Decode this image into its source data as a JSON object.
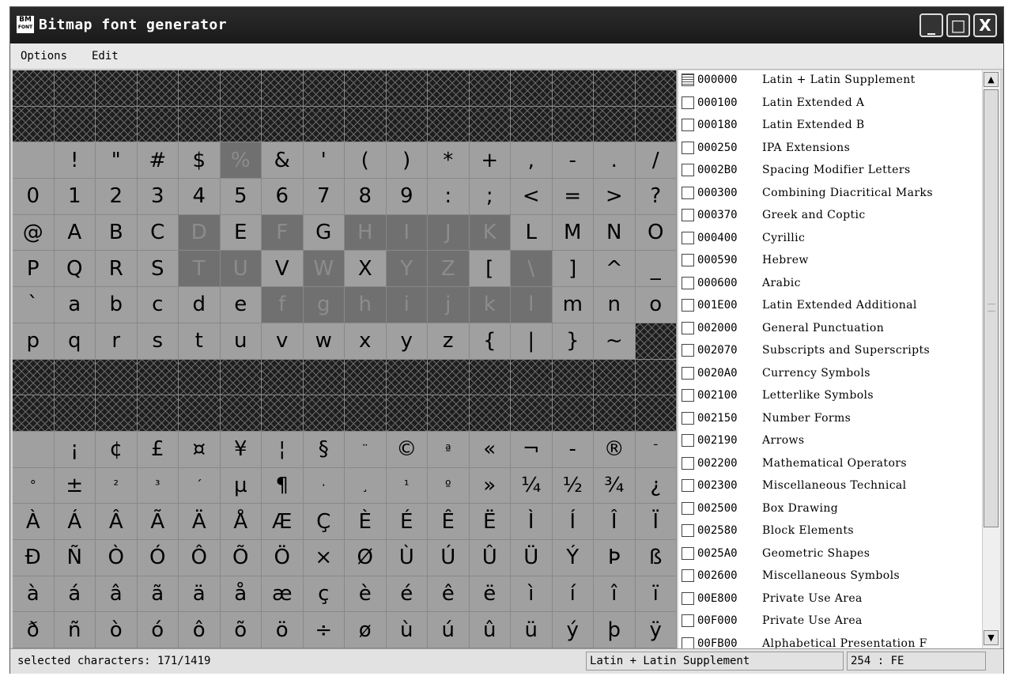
{
  "window": {
    "app_icon_top": "BM",
    "app_icon_bottom": "FONT",
    "title": "Bitmap font generator"
  },
  "window_controls": {
    "minimize": "_",
    "maximize": "□",
    "close": "X"
  },
  "menu": [
    "Options",
    "Edit"
  ],
  "char_grid": {
    "columns": 16,
    "rows": [
      {
        "chars": [
          "",
          "",
          "",
          "",
          "",
          "",
          "",
          "",
          "",
          "",
          "",
          "",
          "",
          "",
          "",
          ""
        ],
        "unavailable": [
          0,
          1,
          2,
          3,
          4,
          5,
          6,
          7,
          8,
          9,
          10,
          11,
          12,
          13,
          14,
          15
        ],
        "selected": []
      },
      {
        "chars": [
          "",
          "",
          "",
          "",
          "",
          "",
          "",
          "",
          "",
          "",
          "",
          "",
          "",
          "",
          "",
          ""
        ],
        "unavailable": [
          0,
          1,
          2,
          3,
          4,
          5,
          6,
          7,
          8,
          9,
          10,
          11,
          12,
          13,
          14,
          15
        ],
        "selected": []
      },
      {
        "chars": [
          " ",
          "!",
          "\"",
          "#",
          "$",
          "%",
          "&",
          "'",
          "(",
          ")",
          "*",
          "+",
          ",",
          "-",
          ".",
          "/"
        ],
        "unavailable": [],
        "selected": [
          5
        ]
      },
      {
        "chars": [
          "0",
          "1",
          "2",
          "3",
          "4",
          "5",
          "6",
          "7",
          "8",
          "9",
          ":",
          ";",
          "<",
          "=",
          ">",
          "?"
        ],
        "unavailable": [],
        "selected": []
      },
      {
        "chars": [
          "@",
          "A",
          "B",
          "C",
          "D",
          "E",
          "F",
          "G",
          "H",
          "I",
          "J",
          "K",
          "L",
          "M",
          "N",
          "O"
        ],
        "unavailable": [],
        "selected": [
          4,
          6,
          8,
          9,
          10,
          11
        ]
      },
      {
        "chars": [
          "P",
          "Q",
          "R",
          "S",
          "T",
          "U",
          "V",
          "W",
          "X",
          "Y",
          "Z",
          "[",
          "\\",
          "]",
          "^",
          "_"
        ],
        "unavailable": [],
        "selected": [
          4,
          5,
          7,
          9,
          10,
          12
        ]
      },
      {
        "chars": [
          "`",
          "a",
          "b",
          "c",
          "d",
          "e",
          "f",
          "g",
          "h",
          "i",
          "j",
          "k",
          "l",
          "m",
          "n",
          "o"
        ],
        "unavailable": [],
        "selected": [
          6,
          7,
          8,
          9,
          10,
          11,
          12
        ]
      },
      {
        "chars": [
          "p",
          "q",
          "r",
          "s",
          "t",
          "u",
          "v",
          "w",
          "x",
          "y",
          "z",
          "{",
          "|",
          "}",
          "~",
          ""
        ],
        "unavailable": [
          15
        ],
        "selected": []
      },
      {
        "chars": [
          "",
          "",
          "",
          "",
          "",
          "",
          "",
          "",
          "",
          "",
          "",
          "",
          "",
          "",
          "",
          ""
        ],
        "unavailable": [
          0,
          1,
          2,
          3,
          4,
          5,
          6,
          7,
          8,
          9,
          10,
          11,
          12,
          13,
          14,
          15
        ],
        "selected": []
      },
      {
        "chars": [
          "",
          "",
          "",
          "",
          "",
          "",
          "",
          "",
          "",
          "",
          "",
          "",
          "",
          "",
          "",
          ""
        ],
        "unavailable": [
          0,
          1,
          2,
          3,
          4,
          5,
          6,
          7,
          8,
          9,
          10,
          11,
          12,
          13,
          14,
          15
        ],
        "selected": []
      },
      {
        "chars": [
          " ",
          "¡",
          "¢",
          "£",
          "¤",
          "¥",
          "¦",
          "§",
          "¨",
          "©",
          "ª",
          "«",
          "¬",
          "-",
          "®",
          "¯"
        ],
        "unavailable": [],
        "selected": []
      },
      {
        "chars": [
          "°",
          "±",
          "²",
          "³",
          "´",
          "µ",
          "¶",
          "·",
          "¸",
          "¹",
          "º",
          "»",
          "¼",
          "½",
          "¾",
          "¿"
        ],
        "unavailable": [],
        "selected": []
      },
      {
        "chars": [
          "À",
          "Á",
          "Â",
          "Ã",
          "Ä",
          "Å",
          "Æ",
          "Ç",
          "È",
          "É",
          "Ê",
          "Ë",
          "Ì",
          "Í",
          "Î",
          "Ï"
        ],
        "unavailable": [],
        "selected": []
      },
      {
        "chars": [
          "Ð",
          "Ñ",
          "Ò",
          "Ó",
          "Ô",
          "Õ",
          "Ö",
          "×",
          "Ø",
          "Ù",
          "Ú",
          "Û",
          "Ü",
          "Ý",
          "Þ",
          "ß"
        ],
        "unavailable": [],
        "selected": []
      },
      {
        "chars": [
          "à",
          "á",
          "â",
          "ã",
          "ä",
          "å",
          "æ",
          "ç",
          "è",
          "é",
          "ê",
          "ë",
          "ì",
          "í",
          "î",
          "ï"
        ],
        "unavailable": [],
        "selected": []
      },
      {
        "chars": [
          "ð",
          "ñ",
          "ò",
          "ó",
          "ô",
          "õ",
          "ö",
          "÷",
          "ø",
          "ù",
          "ú",
          "û",
          "ü",
          "ý",
          "þ",
          "ÿ"
        ],
        "unavailable": [],
        "selected": []
      }
    ]
  },
  "unicode_ranges": [
    {
      "code": "000000",
      "name": "Latin + Latin Supplement",
      "state": "partial"
    },
    {
      "code": "000100",
      "name": "Latin Extended A",
      "state": "unchecked"
    },
    {
      "code": "000180",
      "name": "Latin Extended B",
      "state": "unchecked"
    },
    {
      "code": "000250",
      "name": "IPA Extensions",
      "state": "unchecked"
    },
    {
      "code": "0002B0",
      "name": "Spacing Modifier Letters",
      "state": "unchecked"
    },
    {
      "code": "000300",
      "name": "Combining Diacritical Marks",
      "state": "unchecked"
    },
    {
      "code": "000370",
      "name": "Greek and Coptic",
      "state": "unchecked"
    },
    {
      "code": "000400",
      "name": "Cyrillic",
      "state": "unchecked"
    },
    {
      "code": "000590",
      "name": "Hebrew",
      "state": "unchecked"
    },
    {
      "code": "000600",
      "name": "Arabic",
      "state": "unchecked"
    },
    {
      "code": "001E00",
      "name": "Latin Extended Additional",
      "state": "unchecked"
    },
    {
      "code": "002000",
      "name": "General Punctuation",
      "state": "unchecked"
    },
    {
      "code": "002070",
      "name": "Subscripts and Superscripts",
      "state": "unchecked"
    },
    {
      "code": "0020A0",
      "name": "Currency Symbols",
      "state": "unchecked"
    },
    {
      "code": "002100",
      "name": "Letterlike Symbols",
      "state": "unchecked"
    },
    {
      "code": "002150",
      "name": "Number Forms",
      "state": "unchecked"
    },
    {
      "code": "002190",
      "name": "Arrows",
      "state": "unchecked"
    },
    {
      "code": "002200",
      "name": "Mathematical Operators",
      "state": "unchecked"
    },
    {
      "code": "002300",
      "name": "Miscellaneous Technical",
      "state": "unchecked"
    },
    {
      "code": "002500",
      "name": "Box Drawing",
      "state": "unchecked"
    },
    {
      "code": "002580",
      "name": "Block Elements",
      "state": "unchecked"
    },
    {
      "code": "0025A0",
      "name": "Geometric Shapes",
      "state": "unchecked"
    },
    {
      "code": "002600",
      "name": "Miscellaneous Symbols",
      "state": "unchecked"
    },
    {
      "code": "00E800",
      "name": "Private Use Area",
      "state": "unchecked"
    },
    {
      "code": "00F000",
      "name": "Private Use Area",
      "state": "unchecked"
    },
    {
      "code": "00FB00",
      "name": "Alphabetical Presentation F",
      "state": "unchecked"
    }
  ],
  "scrollbar": {
    "up": "▲",
    "down": "▼"
  },
  "status": {
    "selected": "selected characters: 171/1419",
    "range": "Latin + Latin Supplement",
    "code": "254 : FE"
  }
}
